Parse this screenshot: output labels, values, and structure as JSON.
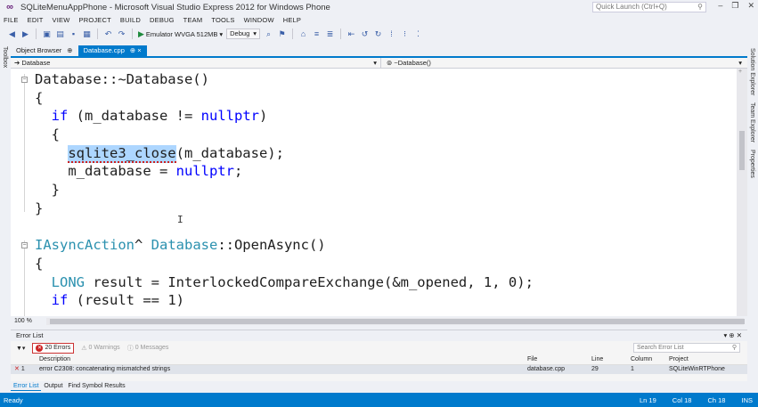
{
  "window": {
    "title": "SQLiteMenuAppPhone - Microsoft Visual Studio Express 2012 for Windows Phone",
    "quick_launch_placeholder": "Quick Launch (Ctrl+Q)",
    "min": "–",
    "restore": "❐",
    "close": "✕"
  },
  "menu": [
    "FILE",
    "EDIT",
    "VIEW",
    "PROJECT",
    "BUILD",
    "DEBUG",
    "TEAM",
    "TOOLS",
    "WINDOW",
    "HELP"
  ],
  "toolbar": {
    "run_target": "Emulator WVGA 512MB",
    "config": "Debug"
  },
  "side": {
    "toolbox": "Toolbox",
    "solution_explorer": "Solution Explorer",
    "team_explorer": "Team Explorer",
    "properties": "Properties"
  },
  "tabs": [
    {
      "label": "Object Browser",
      "pin": "⊕"
    },
    {
      "label": "Database.cpp",
      "pin": "⊕ ×"
    }
  ],
  "navbar": {
    "left": "Database",
    "right": "~Database()"
  },
  "editor": {
    "zoom": "100 %",
    "lines": [
      [
        {
          "t": "Database::~Database()",
          "c": ""
        }
      ],
      [
        {
          "t": "{",
          "c": ""
        }
      ],
      [
        {
          "t": "  ",
          "c": ""
        },
        {
          "t": "if",
          "c": "kw"
        },
        {
          "t": " (m_database != ",
          "c": ""
        },
        {
          "t": "nullptr",
          "c": "kw"
        },
        {
          "t": ")",
          "c": ""
        }
      ],
      [
        {
          "t": "  {",
          "c": ""
        }
      ],
      [
        {
          "t": "    ",
          "c": ""
        },
        {
          "t": "sqlite3_close",
          "c": "hl"
        },
        {
          "t": "(m_database);",
          "c": ""
        }
      ],
      [
        {
          "t": "    m_database = ",
          "c": ""
        },
        {
          "t": "nullptr",
          "c": "kw"
        },
        {
          "t": ";",
          "c": ""
        }
      ],
      [
        {
          "t": "  }",
          "c": ""
        }
      ],
      [
        {
          "t": "}",
          "c": ""
        }
      ],
      [
        {
          "t": "",
          "c": ""
        }
      ],
      [
        {
          "t": "IAsyncAction",
          "c": "ty"
        },
        {
          "t": "^ ",
          "c": ""
        },
        {
          "t": "Database",
          "c": "ty"
        },
        {
          "t": "::OpenAsync()",
          "c": ""
        }
      ],
      [
        {
          "t": "{",
          "c": ""
        }
      ],
      [
        {
          "t": "  ",
          "c": ""
        },
        {
          "t": "LONG",
          "c": "ty"
        },
        {
          "t": " result = InterlockedCompareExchange(&m_opened, 1, 0);",
          "c": ""
        }
      ],
      [
        {
          "t": "  ",
          "c": ""
        },
        {
          "t": "if",
          "c": "kw"
        },
        {
          "t": " (result == 1)",
          "c": ""
        }
      ]
    ]
  },
  "error_list": {
    "title": "Error List",
    "errors_label": "20 Errors",
    "warnings_label": "0 Warnings",
    "messages_label": "0 Messages",
    "search_placeholder": "Search Error List",
    "columns": {
      "description": "Description",
      "file": "File",
      "line": "Line",
      "column": "Column",
      "project": "Project"
    },
    "rows": [
      {
        "num": "1",
        "description": "error C2308: concatenating mismatched strings",
        "file": "database.cpp",
        "line": "29",
        "column": "1",
        "project": "SQLiteWinRTPhone"
      }
    ]
  },
  "bottom_tabs": [
    "Error List",
    "Output",
    "Find Symbol Results"
  ],
  "status": {
    "ready": "Ready",
    "ln": "Ln 19",
    "col": "Col 18",
    "ch": "Ch 18",
    "mode": "INS"
  },
  "colors": {
    "accent": "#007acc",
    "keyword": "#0000ff",
    "type": "#2b91af",
    "selection": "#add6ff"
  }
}
